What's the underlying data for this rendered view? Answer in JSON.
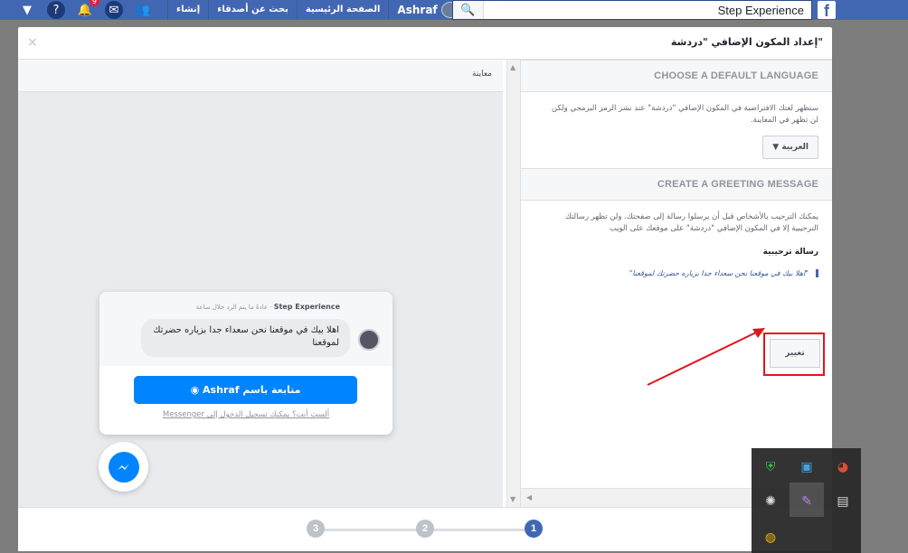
{
  "topbar": {
    "links": [
      "إنشاء",
      "بحث عن أصدقاء",
      "الصفحة الرئيسية"
    ],
    "user_name": "Ashraf",
    "notif_count": "9",
    "search_value": "Step Experience",
    "logo_letter": "f"
  },
  "dialog": {
    "title": "إعداد المكون الإضافي \"دردشة\"",
    "close_glyph": "×",
    "preview_label": "معاينة"
  },
  "language_section": {
    "heading": "CHOOSE A DEFAULT LANGUAGE",
    "description": "ستظهر لغتك الافتراضية في المكون الإضافي \"دردشة\" عند نشر الرمز البرمجي ولكن لن تظهر في المعاينة.",
    "selected_language": "العربية",
    "dropdown_glyph": "▼"
  },
  "greeting_section": {
    "heading": "CREATE A GREETING MESSAGE",
    "description": "يمكنك الترحيب بالأشخاص قبل أن يرسلوا رسالة إلى صفحتك. ولن تظهر رسالتك الترحيبية إلا في المكون الإضافي \"دردشة\" على موقعك على الويب",
    "label": "رسالة ترحيبية",
    "message": "\"اهلا بيك في موقعنا نحن سعداء جدا بزياره حضرتك لموقعنا\"",
    "change_button": "تغيير"
  },
  "chat_preview": {
    "page_name": "Step Experience",
    "response_time": "عادةً ما يتم الرد خلال ساعة",
    "bubble_text": "اهلا بيك في موقعنا نحن سعداء جدا بزياره حضرتك لموقعنا",
    "continue_button": "متابعة باسم Ashraf",
    "login_link": "ألست أنت؟ يمكنك تسجيل الدخول إلى Messenger"
  },
  "steps": {
    "items": [
      "1",
      "2",
      "3"
    ],
    "active": "1"
  },
  "colors": {
    "facebook_blue": "#4267b2",
    "messenger_blue": "#0084ff",
    "highlight_red": "#e5131a"
  },
  "tray_icons": [
    "shield-icon",
    "monitor-icon",
    "color-ball-icon",
    "satellite-icon",
    "pen-icon",
    "computer-icon",
    "chrome-icon"
  ]
}
